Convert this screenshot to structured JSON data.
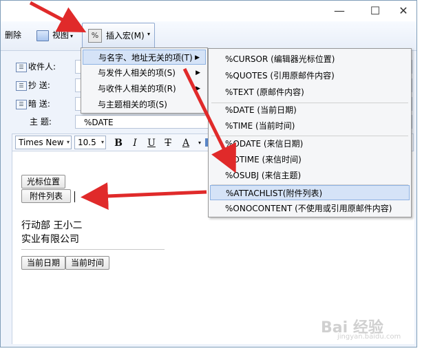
{
  "window": {
    "controls": [
      "—",
      "☐",
      "✕"
    ]
  },
  "toolbar": {
    "delete_label": "删除",
    "view_label": "视图",
    "insert_macro_label": "插入宏(M)",
    "macro_icon_text": "%"
  },
  "fields": {
    "to_label": "收件人:",
    "cc_label": "抄   送:",
    "bcc_label": "暗   送:",
    "subject_label": "主   题:",
    "subject_value": "%DATE"
  },
  "format_bar": {
    "font": "Times New",
    "size": "10.5"
  },
  "editor": {
    "cursor_chip": "光标位置",
    "attach_chip": "附件列表",
    "sig_line1": "行动部    王小二",
    "sig_line2": "实业有限公司",
    "date_chip": "当前日期",
    "time_chip": "当前时间"
  },
  "menu1": {
    "items": [
      "与名字、地址无关的项(T)",
      "与发件人相关的项(S)",
      "与收件人相关的项(R)",
      "与主题相关的项(S)"
    ]
  },
  "menu2": {
    "items": [
      "%CURSOR (编辑器光标位置)",
      "%QUOTES (引用原邮件内容)",
      "%TEXT (原邮件内容)",
      "%DATE (当前日期)",
      "%TIME (当前时间)",
      "%ODATE (来信日期)",
      "%OTIME (来信时间)",
      "%OSUBJ (来信主题)",
      "%ATTACHLIST(附件列表)",
      "%ONOCONTENT (不使用或引用原邮件内容)"
    ]
  },
  "watermark": {
    "text": "Bai 经验",
    "sub": "jingyan.baidu.com"
  },
  "colors": {
    "arrow": "#e02a2a",
    "highlight": "#d5e3f7"
  }
}
